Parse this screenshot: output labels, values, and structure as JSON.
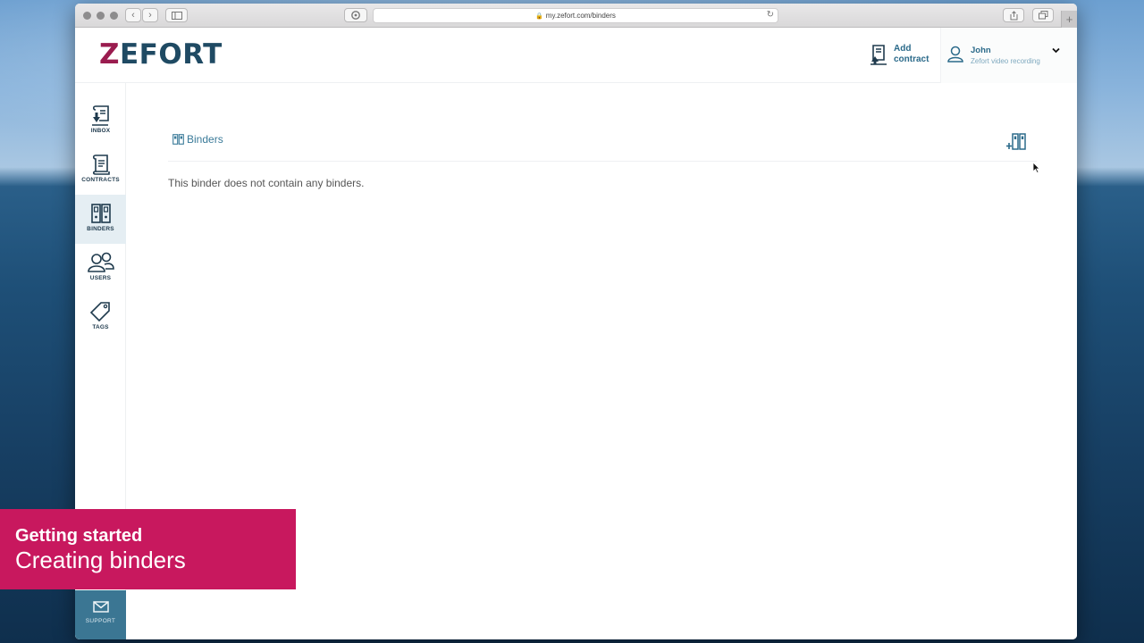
{
  "browser": {
    "url": "my.zefort.com/binders"
  },
  "header": {
    "logo_z": "Z",
    "logo_rest": "EFORT",
    "add_contract_line1": "Add",
    "add_contract_line2": "contract",
    "user_name": "John",
    "user_subtitle": "Zefort video recording"
  },
  "sidebar": {
    "items": [
      {
        "label": "INBOX",
        "icon": "inbox-icon"
      },
      {
        "label": "CONTRACTS",
        "icon": "contracts-icon"
      },
      {
        "label": "BINDERS",
        "icon": "binders-icon",
        "active": true
      },
      {
        "label": "USERS",
        "icon": "users-icon"
      },
      {
        "label": "TAGS",
        "icon": "tag-icon"
      }
    ],
    "support_label": "SUPPORT"
  },
  "main": {
    "breadcrumb": "Binders",
    "empty_message": "This binder does not contain any binders."
  },
  "overlay": {
    "line1": "Getting started",
    "line2": "Creating binders"
  },
  "colors": {
    "brand_magenta": "#9a1c4f",
    "brand_navy": "#1f4a63",
    "link_blue": "#3a7a99",
    "active_nav_bg": "#e5eef3",
    "support_bg": "#3b7693",
    "banner_bg": "#c8185e"
  }
}
